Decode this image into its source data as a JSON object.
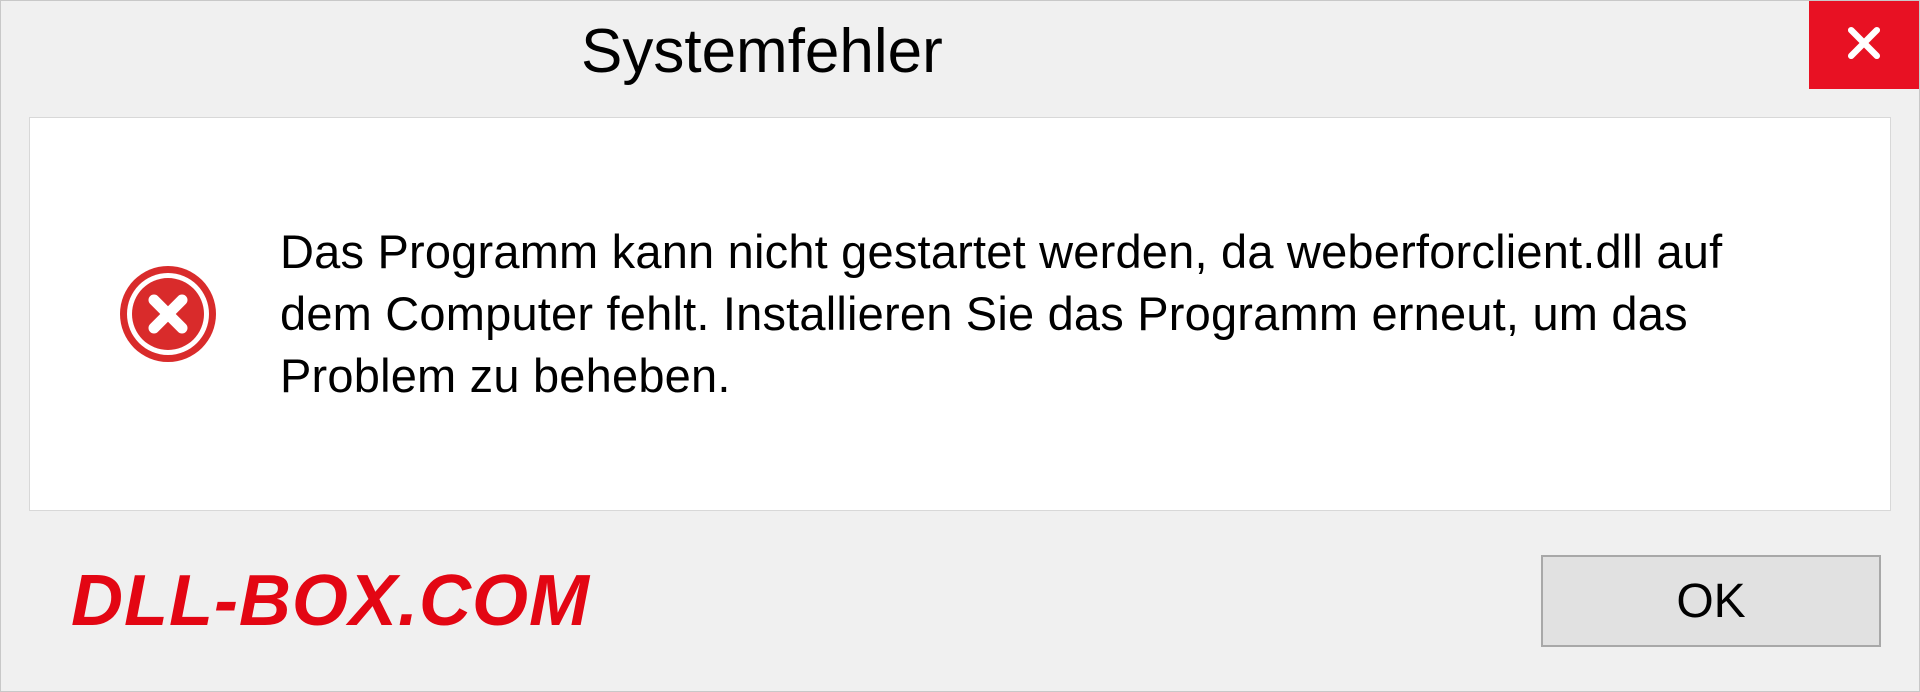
{
  "dialog": {
    "title": "Systemfehler",
    "message": "Das Programm kann nicht gestartet werden, da weberforclient.dll auf dem Computer fehlt. Installieren Sie das Programm erneut, um das Problem zu beheben.",
    "ok_label": "OK"
  },
  "watermark": "DLL-BOX.COM",
  "colors": {
    "close_bg": "#e81123",
    "error_red": "#d92b2b",
    "watermark_red": "#e30613"
  }
}
